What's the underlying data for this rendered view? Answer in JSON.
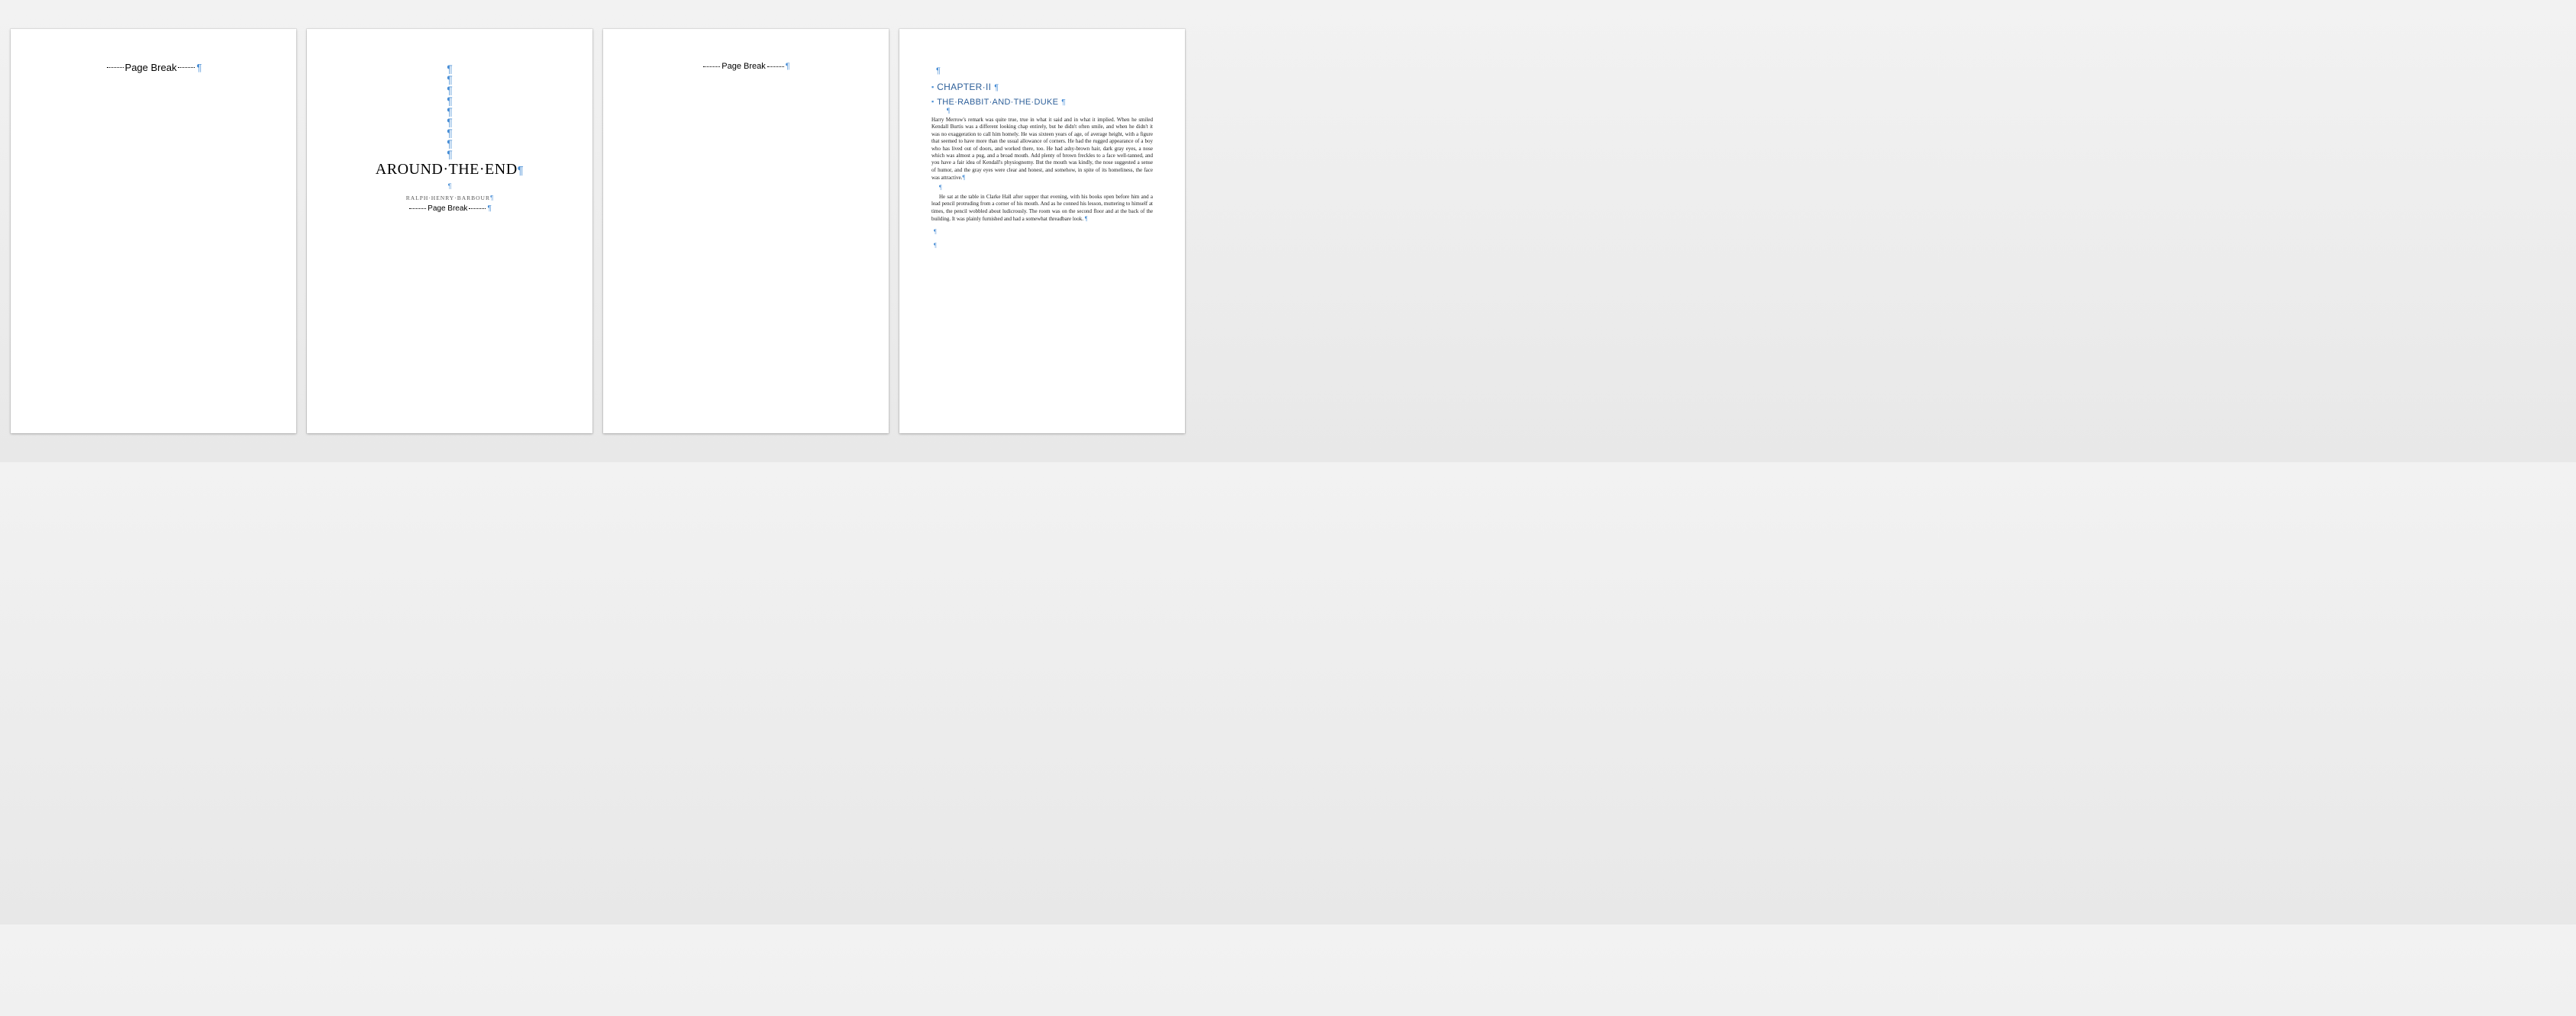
{
  "marks": {
    "page_break_label": "Page Break",
    "pilcrow": "¶"
  },
  "page2": {
    "empty_para_count": 9,
    "title": "AROUND·THE·END",
    "author": "RALPH·HENRY·BARBOUR"
  },
  "page4": {
    "chapter_label": "CHAPTER·II",
    "subheading": "THE·RABBIT·AND·THE·DUKE",
    "para1": "Harry Merrow's remark was quite true, true in what it said and in what it implied. When he smiled Kendall Burtis was a different looking chap entirely, but he didn't often smile, and when he didn't it was no exaggeration to call him homely. He was sixteen years of age, of average height, with a figure that seemed to have more than the usual allowance of corners. He had the rugged appearance of a boy who has lived out of doors, and worked there, too. He had ashy-brown hair, dark gray eyes, a nose which was almost a pug, and a broad mouth. Add plenty of brown freckles to a face well-tanned, and you have a fair idea of Kendall's physiognomy. But the mouth was kindly, the nose suggested a sense of humor, and the gray eyes were clear and honest, and somehow, in spite of its homeliness, the face was attractive.",
    "para2": "He sat at the table in Clarke Hall after supper that evening, with his books open before him and a lead pencil protruding from a corner of his mouth. And as he conned his lesson, muttering to himself at times, the pencil wobbled about ludicrously. The room was on the second floor and at the back of the building. It was plainly furnished and had a somewhat threadbare look. "
  }
}
